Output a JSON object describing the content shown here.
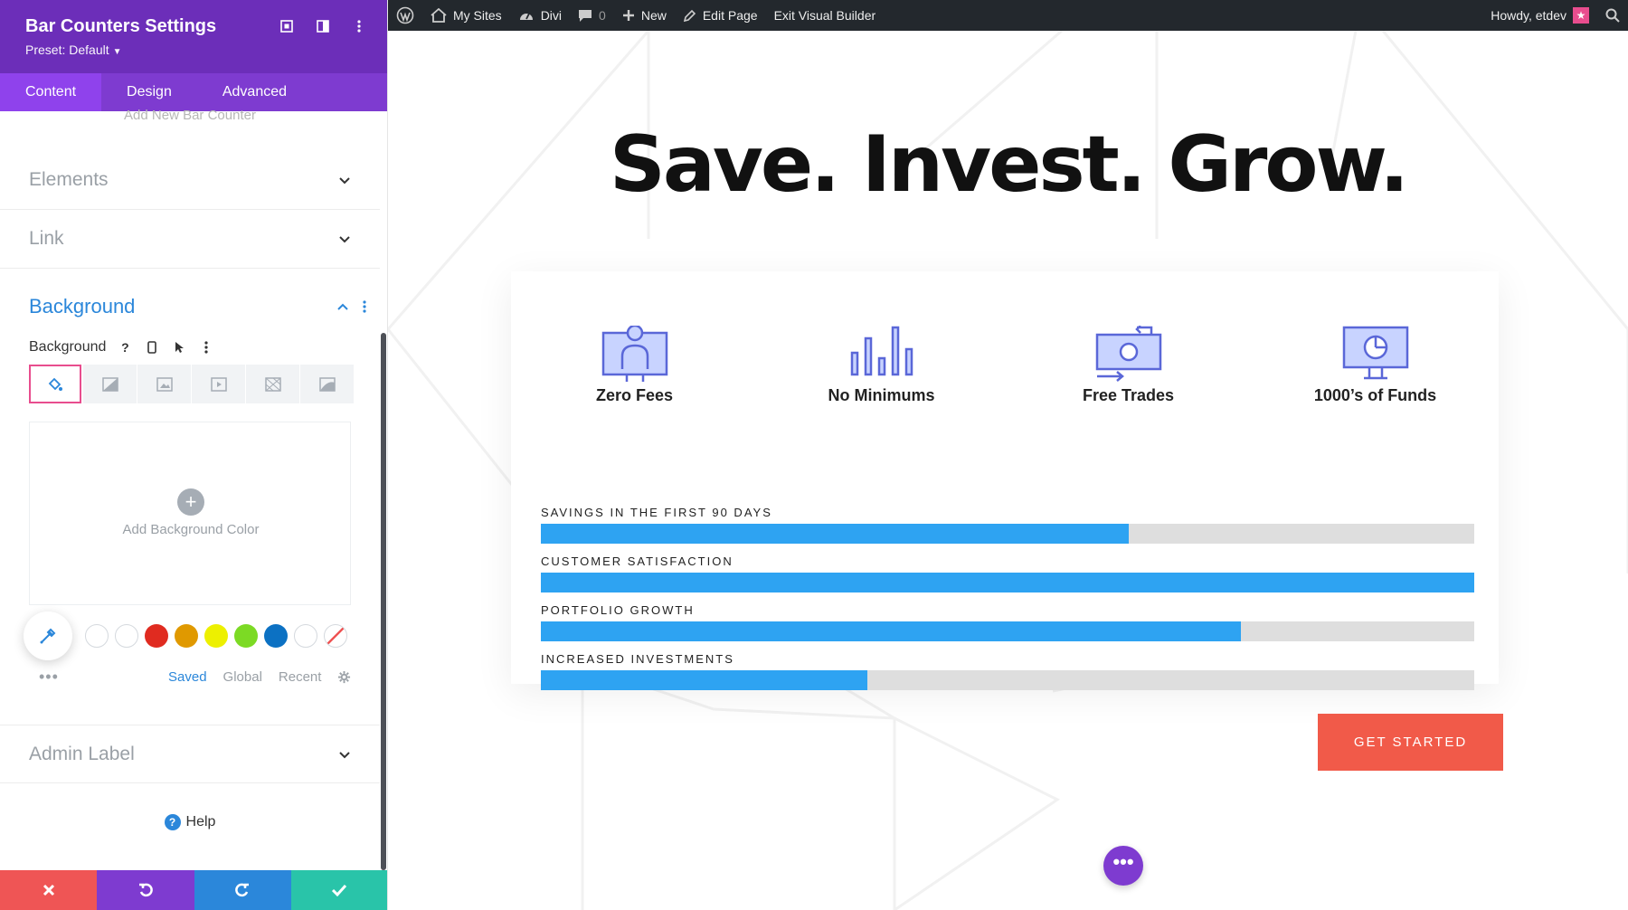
{
  "panel": {
    "title": "Bar Counters Settings",
    "preset": "Preset: Default",
    "tabs": [
      {
        "label": "Content",
        "active": true
      },
      {
        "label": "Design",
        "active": false
      },
      {
        "label": "Advanced",
        "active": false
      }
    ],
    "faded_item": "Add New Bar Counter",
    "sections": {
      "elements": "Elements",
      "link": "Link",
      "background": "Background",
      "admin_label": "Admin Label"
    },
    "background_field_label": "Background",
    "add_background_color": "Add Background Color",
    "swatch_colors": [
      "#ffffff",
      "#ffffff",
      "#e02b20",
      "#e09900",
      "#edf000",
      "#7cda24",
      "#0c71c3",
      "#ffffff"
    ],
    "swatch_tabs": [
      {
        "label": "Saved",
        "active": true
      },
      {
        "label": "Global",
        "active": false
      },
      {
        "label": "Recent",
        "active": false
      }
    ],
    "help": "Help",
    "footer_colors": [
      "#ef5555",
      "#7e3bd0",
      "#2b87da",
      "#29c4a9"
    ]
  },
  "adminbar": {
    "my_sites": "My Sites",
    "site": "Divi",
    "comments": "0",
    "new": "New",
    "edit_page": "Edit Page",
    "exit_builder": "Exit Visual Builder",
    "howdy": "Howdy, etdev"
  },
  "page": {
    "headline": "Save. Invest. Grow.",
    "features": [
      {
        "label": "Zero Fees",
        "icon": "person-monitor-icon"
      },
      {
        "label": "No Minimums",
        "icon": "bar-chart-icon"
      },
      {
        "label": "Free Trades",
        "icon": "money-transfer-icon"
      },
      {
        "label": "1000’s of Funds",
        "icon": "monitor-pie-icon"
      }
    ],
    "bars": [
      {
        "label": "SAVINGS IN THE FIRST 90 DAYS",
        "percent": 63
      },
      {
        "label": "CUSTOMER SATISFACTION",
        "percent": 100
      },
      {
        "label": "PORTFOLIO GROWTH",
        "percent": 75
      },
      {
        "label": "INCREASED INVESTMENTS",
        "percent": 35
      }
    ],
    "cta": "GET STARTED",
    "fab": "•••"
  },
  "colors": {
    "purple": "#6c2eb9",
    "blue_bar": "#2ea3f2",
    "cta": "#f15a49"
  }
}
